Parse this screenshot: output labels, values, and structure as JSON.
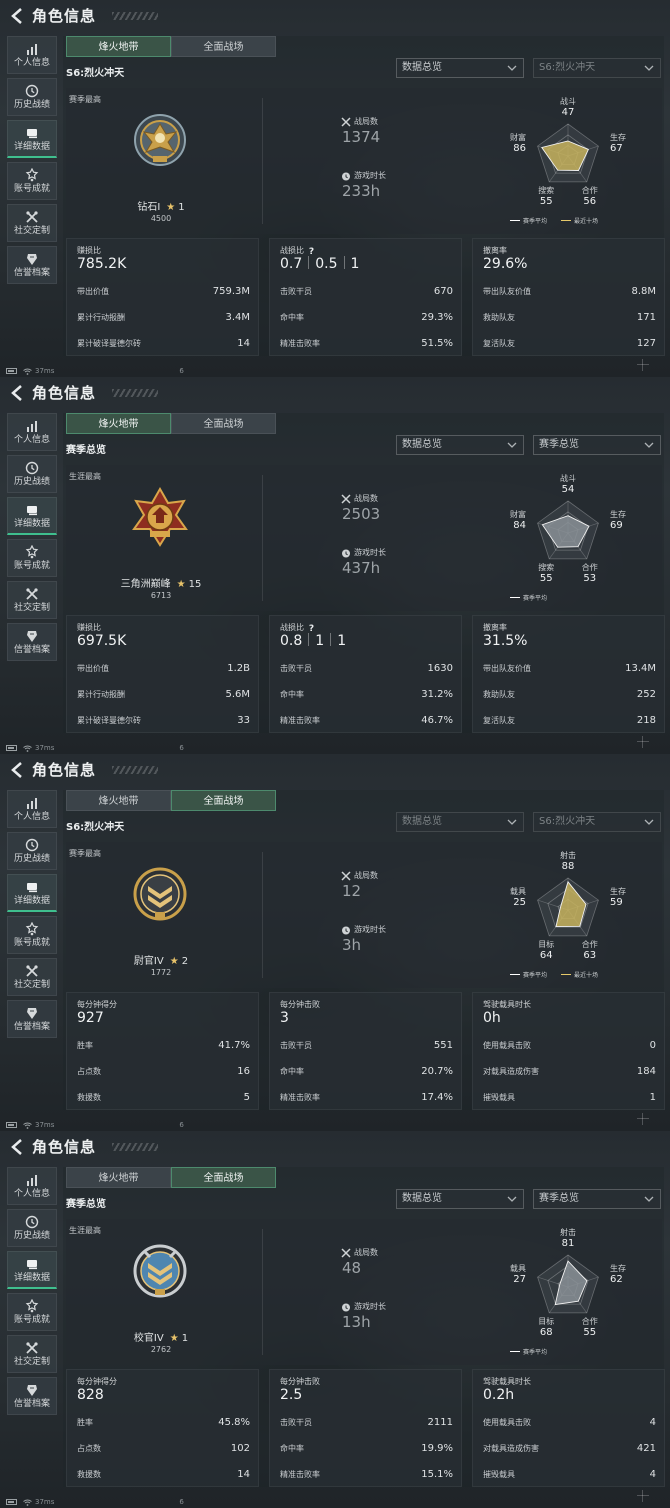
{
  "colors": {
    "accent": "#3fbf8e",
    "season_avg_series": "#ffffff",
    "recent_ten_series": "#e6c96a",
    "gold_badge": "#c9a04a",
    "blue_badge": "#4f86b0"
  },
  "screens": [
    {
      "page_title": "角色信息",
      "sidebar": [
        {
          "label": "个人信息",
          "icon": "bar-chart-icon",
          "active": false
        },
        {
          "label": "历史战绩",
          "icon": "history-icon",
          "active": false
        },
        {
          "label": "详细数据",
          "icon": "detail-icon",
          "active": true
        },
        {
          "label": "账号成就",
          "icon": "achievement-icon",
          "active": false
        },
        {
          "label": "社交定制",
          "icon": "tools-icon",
          "active": false
        },
        {
          "label": "信誉档案",
          "icon": "credit-icon",
          "active": false
        }
      ],
      "tabs": [
        {
          "label": "烽火地带",
          "active": true
        },
        {
          "label": "全面战场",
          "active": false
        }
      ],
      "subtitle": "S6:烈火冲天",
      "select1": "数据总览",
      "select2": "S6:烈火冲天",
      "select2_dim": true,
      "summary_label": "赛季最高",
      "badge_style": "diamond",
      "rank_name": "钻石I",
      "rank_stars": "1",
      "rank_score": "4500",
      "stat1_label": "战局数",
      "stat1_value": "1374",
      "stat2_label": "游戏时长",
      "stat2_value": "233h",
      "radar": {
        "labels": [
          "战斗",
          "生存",
          "合作",
          "搜索",
          "财富"
        ],
        "values": [
          "47",
          "67",
          "56",
          "55",
          "86"
        ],
        "fill_color": "#c7b35e",
        "legend": [
          "赛季平均",
          "最近十场"
        ]
      },
      "cards": [
        {
          "label": "赚损比",
          "help": false,
          "value_parts": [
            "785.2K"
          ],
          "rows": [
            {
              "label": "带出价值",
              "value": "759.3M"
            },
            {
              "label": "累计行动报酬",
              "value": "3.4M"
            },
            {
              "label": "累计破译曼德尔砖",
              "value": "14"
            }
          ]
        },
        {
          "label": "战损比",
          "help": true,
          "value_parts": [
            "0.7",
            "0.5",
            "1"
          ],
          "rows": [
            {
              "label": "击败干员",
              "value": "670"
            },
            {
              "label": "命中率",
              "value": "29.3%"
            },
            {
              "label": "精准击败率",
              "value": "51.5%"
            }
          ]
        },
        {
          "label": "撤离率",
          "help": false,
          "value_parts": [
            "29.6%"
          ],
          "rows": [
            {
              "label": "带出队友价值",
              "value": "8.8M"
            },
            {
              "label": "救助队友",
              "value": "171"
            },
            {
              "label": "复活队友",
              "value": "127"
            }
          ]
        }
      ],
      "status": {
        "ping": "37ms",
        "tail": "6"
      }
    },
    {
      "page_title": "角色信息",
      "sidebar": [
        {
          "label": "个人信息",
          "icon": "bar-chart-icon",
          "active": false
        },
        {
          "label": "历史战绩",
          "icon": "history-icon",
          "active": false
        },
        {
          "label": "详细数据",
          "icon": "detail-icon",
          "active": true
        },
        {
          "label": "账号成就",
          "icon": "achievement-icon",
          "active": false
        },
        {
          "label": "社交定制",
          "icon": "tools-icon",
          "active": false
        },
        {
          "label": "信誉档案",
          "icon": "credit-icon",
          "active": false
        }
      ],
      "tabs": [
        {
          "label": "烽火地带",
          "active": true
        },
        {
          "label": "全面战场",
          "active": false
        }
      ],
      "subtitle": "赛季总览",
      "select1": "数据总览",
      "select2": "赛季总览",
      "select2_dim": false,
      "summary_label": "生涯最高",
      "badge_style": "peak",
      "rank_name": "三角洲巅峰",
      "rank_stars": "15",
      "rank_score": "6713",
      "stat1_label": "战局数",
      "stat1_value": "2503",
      "stat2_label": "游戏时长",
      "stat2_value": "437h",
      "radar": {
        "labels": [
          "战斗",
          "生存",
          "合作",
          "搜索",
          "财富"
        ],
        "values": [
          "54",
          "69",
          "53",
          "55",
          "84"
        ],
        "fill_color": "#8a9196",
        "legend": [
          "赛季平均"
        ]
      },
      "cards": [
        {
          "label": "赚损比",
          "help": false,
          "value_parts": [
            "697.5K"
          ],
          "rows": [
            {
              "label": "带出价值",
              "value": "1.2B"
            },
            {
              "label": "累计行动报酬",
              "value": "5.6M"
            },
            {
              "label": "累计破译曼德尔砖",
              "value": "33"
            }
          ]
        },
        {
          "label": "战损比",
          "help": true,
          "value_parts": [
            "0.8",
            "1",
            "1"
          ],
          "rows": [
            {
              "label": "击败干员",
              "value": "1630"
            },
            {
              "label": "命中率",
              "value": "31.2%"
            },
            {
              "label": "精准击败率",
              "value": "46.7%"
            }
          ]
        },
        {
          "label": "撤离率",
          "help": false,
          "value_parts": [
            "31.5%"
          ],
          "rows": [
            {
              "label": "带出队友价值",
              "value": "13.4M"
            },
            {
              "label": "救助队友",
              "value": "252"
            },
            {
              "label": "复活队友",
              "value": "218"
            }
          ]
        }
      ],
      "status": {
        "ping": "37ms",
        "tail": "6"
      }
    },
    {
      "page_title": "角色信息",
      "sidebar": [
        {
          "label": "个人信息",
          "icon": "bar-chart-icon",
          "active": false
        },
        {
          "label": "历史战绩",
          "icon": "history-icon",
          "active": false
        },
        {
          "label": "详细数据",
          "icon": "detail-icon",
          "active": true
        },
        {
          "label": "账号成就",
          "icon": "achievement-icon",
          "active": false
        },
        {
          "label": "社交定制",
          "icon": "tools-icon",
          "active": false
        },
        {
          "label": "信誉档案",
          "icon": "credit-icon",
          "active": false
        }
      ],
      "tabs": [
        {
          "label": "烽火地带",
          "active": false
        },
        {
          "label": "全面战场",
          "active": true
        }
      ],
      "subtitle": "S6:烈火冲天",
      "select1": "数据总览",
      "select2": "S6:烈火冲天",
      "select1_dim": true,
      "select2_dim": true,
      "summary_label": "赛季最高",
      "badge_style": "officer-gold",
      "rank_name": "尉官IV",
      "rank_stars": "2",
      "rank_score": "1772",
      "stat1_label": "战局数",
      "stat1_value": "12",
      "stat2_label": "游戏时长",
      "stat2_value": "3h",
      "radar": {
        "labels": [
          "射击",
          "生存",
          "合作",
          "目标",
          "载具"
        ],
        "values": [
          "88",
          "59",
          "63",
          "64",
          "25"
        ],
        "fill_color": "#c7b35e",
        "legend": [
          "赛季平均",
          "最近十场"
        ]
      },
      "cards": [
        {
          "label": "每分钟得分",
          "help": false,
          "value_parts": [
            "927"
          ],
          "rows": [
            {
              "label": "胜率",
              "value": "41.7%"
            },
            {
              "label": "占点数",
              "value": "16"
            },
            {
              "label": "救援数",
              "value": "5"
            }
          ]
        },
        {
          "label": "每分钟击败",
          "help": false,
          "value_parts": [
            "3"
          ],
          "rows": [
            {
              "label": "击败干员",
              "value": "551"
            },
            {
              "label": "命中率",
              "value": "20.7%"
            },
            {
              "label": "精准击败率",
              "value": "17.4%"
            }
          ]
        },
        {
          "label": "驾驶载具时长",
          "help": false,
          "value_parts": [
            "0h"
          ],
          "rows": [
            {
              "label": "使用载具击败",
              "value": "0"
            },
            {
              "label": "对载具造成伤害",
              "value": "184"
            },
            {
              "label": "摧毁载具",
              "value": "1"
            }
          ]
        }
      ],
      "status": {
        "ping": "37ms",
        "tail": "6"
      }
    },
    {
      "page_title": "角色信息",
      "sidebar": [
        {
          "label": "个人信息",
          "icon": "bar-chart-icon",
          "active": false
        },
        {
          "label": "历史战绩",
          "icon": "history-icon",
          "active": false
        },
        {
          "label": "详细数据",
          "icon": "detail-icon",
          "active": true
        },
        {
          "label": "账号成就",
          "icon": "achievement-icon",
          "active": false
        },
        {
          "label": "社交定制",
          "icon": "tools-icon",
          "active": false
        },
        {
          "label": "信誉档案",
          "icon": "credit-icon",
          "active": false
        }
      ],
      "tabs": [
        {
          "label": "烽火地带",
          "active": false
        },
        {
          "label": "全面战场",
          "active": true
        }
      ],
      "subtitle": "赛季总览",
      "select1": "数据总览",
      "select2": "赛季总览",
      "select2_dim": false,
      "summary_label": "生涯最高",
      "badge_style": "officer-blue",
      "rank_name": "校官IV",
      "rank_stars": "1",
      "rank_score": "2762",
      "stat1_label": "战局数",
      "stat1_value": "48",
      "stat2_label": "游戏时长",
      "stat2_value": "13h",
      "radar": {
        "labels": [
          "射击",
          "生存",
          "合作",
          "目标",
          "载具"
        ],
        "values": [
          "81",
          "62",
          "55",
          "68",
          "27"
        ],
        "fill_color": "#8a9196",
        "legend": [
          "赛季平均"
        ]
      },
      "cards": [
        {
          "label": "每分钟得分",
          "help": false,
          "value_parts": [
            "828"
          ],
          "rows": [
            {
              "label": "胜率",
              "value": "45.8%"
            },
            {
              "label": "占点数",
              "value": "102"
            },
            {
              "label": "救援数",
              "value": "14"
            }
          ]
        },
        {
          "label": "每分钟击败",
          "help": false,
          "value_parts": [
            "2.5"
          ],
          "rows": [
            {
              "label": "击败干员",
              "value": "2111"
            },
            {
              "label": "命中率",
              "value": "19.9%"
            },
            {
              "label": "精准击败率",
              "value": "15.1%"
            }
          ]
        },
        {
          "label": "驾驶载具时长",
          "help": false,
          "value_parts": [
            "0.2h"
          ],
          "rows": [
            {
              "label": "使用载具击败",
              "value": "4"
            },
            {
              "label": "对载具造成伤害",
              "value": "421"
            },
            {
              "label": "摧毁载具",
              "value": "4"
            }
          ]
        }
      ],
      "status": {
        "ping": "37ms",
        "tail": "6"
      }
    }
  ]
}
